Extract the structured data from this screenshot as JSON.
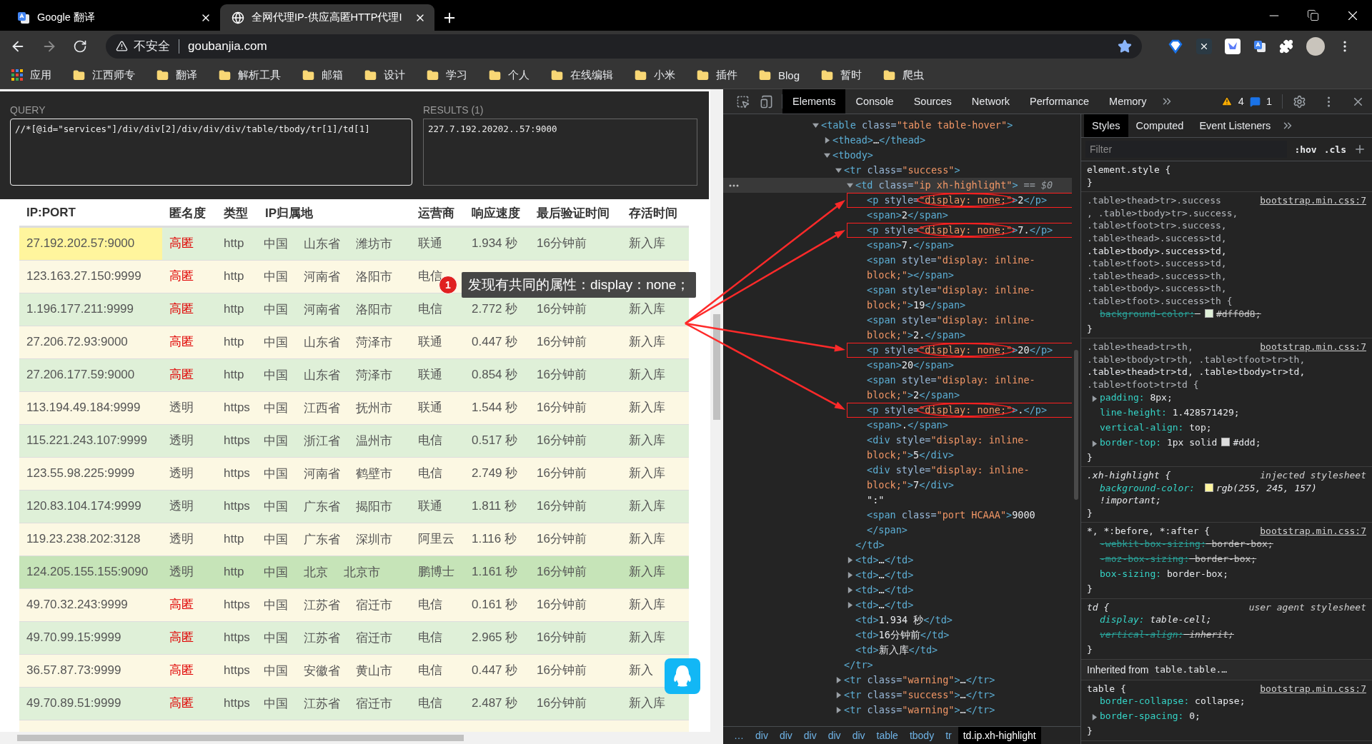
{
  "browser": {
    "tabs": [
      {
        "title": "Google 翻译",
        "kind": "translate",
        "selected": false
      },
      {
        "title": "全网代理IP-供应高匿HTTP代理I",
        "kind": "globe",
        "selected": true
      }
    ],
    "security": "不安全",
    "url": "goubanjia.com",
    "bookmarks": [
      {
        "kind": "apps",
        "label": "应用"
      },
      {
        "kind": "folder",
        "label": "江西师专"
      },
      {
        "kind": "folder",
        "label": "翻译"
      },
      {
        "kind": "folder",
        "label": "解析工具"
      },
      {
        "kind": "folder",
        "label": "邮箱"
      },
      {
        "kind": "folder",
        "label": "设计"
      },
      {
        "kind": "folder",
        "label": "学习"
      },
      {
        "kind": "folder",
        "label": "个人"
      },
      {
        "kind": "folder",
        "label": "在线编辑"
      },
      {
        "kind": "folder",
        "label": "小米"
      },
      {
        "kind": "folder",
        "label": "插件"
      },
      {
        "kind": "folder",
        "label": "Blog"
      },
      {
        "kind": "folder",
        "label": "暂时"
      },
      {
        "kind": "folder",
        "label": "爬虫"
      }
    ]
  },
  "page": {
    "xpath_helper": {
      "query_label": "QUERY",
      "query": "//*[@id=\"services\"]/div/div[2]/div/div/div/table/tbody/tr[1]/td[1]",
      "results_label": "RESULTS (1)",
      "result": "227.7.192.20202..57:9000"
    },
    "columns": [
      "IP:PORT",
      "匿名度",
      "类型",
      "IP归属地",
      "运营商",
      "响应速度",
      "最后验证时间",
      "存活时间"
    ],
    "rows": [
      {
        "kind": "success",
        "hovered": false,
        "ip_highlighted": true,
        "ip": "27.192.202.57:9000",
        "anonymity": "高匿",
        "color": "#e00000",
        "type": "http",
        "location": [
          "中国",
          "山东省",
          "潍坊市"
        ],
        "isp": "联通",
        "speed": "1.934 秒",
        "verified": "16分钟前",
        "lifetime": "新入库"
      },
      {
        "kind": "warning",
        "hovered": false,
        "ip_highlighted": false,
        "ip": "123.163.27.150:9999",
        "anonymity": "高匿",
        "color": "#e00000",
        "type": "http",
        "location": [
          "中国",
          "河南省",
          "洛阳市"
        ],
        "isp": "电信"
      },
      {
        "kind": "success",
        "hovered": false,
        "ip_highlighted": false,
        "ip": "1.196.177.211:9999",
        "anonymity": "高匿",
        "color": "#e00000",
        "type": "http",
        "location": [
          "中国",
          "河南省",
          "洛阳市"
        ],
        "isp": "电信",
        "speed": "2.772 秒",
        "verified": "16分钟前",
        "lifetime": "新入库"
      },
      {
        "kind": "warning",
        "hovered": false,
        "ip_highlighted": false,
        "ip": "27.206.72.93:9000",
        "anonymity": "高匿",
        "color": "#e00000",
        "type": "http",
        "location": [
          "中国",
          "山东省",
          "菏泽市"
        ],
        "isp": "联通",
        "speed": "0.447 秒",
        "verified": "16分钟前",
        "lifetime": "新入库"
      },
      {
        "kind": "success",
        "hovered": false,
        "ip_highlighted": false,
        "ip": "27.206.177.59:9000",
        "anonymity": "高匿",
        "color": "#e00000",
        "type": "http",
        "location": [
          "中国",
          "山东省",
          "菏泽市"
        ],
        "isp": "联通",
        "speed": "0.854 秒",
        "verified": "16分钟前",
        "lifetime": "新入库"
      },
      {
        "kind": "warning",
        "hovered": false,
        "ip_highlighted": false,
        "ip": "113.194.49.184:9999",
        "anonymity": "透明",
        "color": "#555555",
        "type": "https",
        "location": [
          "中国",
          "江西省",
          "抚州市"
        ],
        "isp": "联通",
        "speed": "1.544 秒",
        "verified": "16分钟前",
        "lifetime": "新入库"
      },
      {
        "kind": "success",
        "hovered": false,
        "ip_highlighted": false,
        "ip": "115.221.243.107:9999",
        "anonymity": "透明",
        "color": "#555555",
        "type": "https",
        "location": [
          "中国",
          "浙江省",
          "温州市"
        ],
        "isp": "电信",
        "speed": "0.517 秒",
        "verified": "16分钟前",
        "lifetime": "新入库"
      },
      {
        "kind": "warning",
        "hovered": false,
        "ip_highlighted": false,
        "ip": "123.55.98.225:9999",
        "anonymity": "透明",
        "color": "#555555",
        "type": "https",
        "location": [
          "中国",
          "河南省",
          "鹤壁市"
        ],
        "isp": "电信",
        "speed": "2.749 秒",
        "verified": "16分钟前",
        "lifetime": "新入库"
      },
      {
        "kind": "success",
        "hovered": false,
        "ip_highlighted": false,
        "ip": "120.83.104.174:9999",
        "anonymity": "透明",
        "color": "#555555",
        "type": "https",
        "location": [
          "中国",
          "广东省",
          "揭阳市"
        ],
        "isp": "联通",
        "speed": "1.811 秒",
        "verified": "16分钟前",
        "lifetime": "新入库"
      },
      {
        "kind": "warning",
        "hovered": false,
        "ip_highlighted": false,
        "ip": "119.23.238.202:3128",
        "anonymity": "透明",
        "color": "#555555",
        "type": "http",
        "location": [
          "中国",
          "广东省",
          "深圳市"
        ],
        "isp": "阿里云",
        "speed": "1.116 秒",
        "verified": "16分钟前",
        "lifetime": "新入库"
      },
      {
        "kind": "success",
        "hovered": true,
        "ip_highlighted": false,
        "ip": "124.205.155.155:9090",
        "anonymity": "透明",
        "color": "#555555",
        "type": "http",
        "location": [
          "中国",
          "北京",
          "北京市"
        ],
        "isp": "鹏博士",
        "speed": "1.161 秒",
        "verified": "16分钟前",
        "lifetime": "新入库"
      },
      {
        "kind": "warning",
        "hovered": false,
        "ip_highlighted": false,
        "ip": "49.70.32.243:9999",
        "anonymity": "高匿",
        "color": "#e00000",
        "type": "https",
        "location": [
          "中国",
          "江苏省",
          "宿迁市"
        ],
        "isp": "电信",
        "speed": "0.161 秒",
        "verified": "16分钟前",
        "lifetime": "新入库"
      },
      {
        "kind": "success",
        "hovered": false,
        "ip_highlighted": false,
        "ip": "49.70.99.15:9999",
        "anonymity": "高匿",
        "color": "#e00000",
        "type": "https",
        "location": [
          "中国",
          "江苏省",
          "宿迁市"
        ],
        "isp": "电信",
        "speed": "2.965 秒",
        "verified": "16分钟前",
        "lifetime": "新入库"
      },
      {
        "kind": "warning",
        "hovered": false,
        "ip_highlighted": false,
        "ip": "36.57.87.73:9999",
        "anonymity": "高匿",
        "color": "#e00000",
        "type": "https",
        "location": [
          "中国",
          "安徽省",
          "黄山市"
        ],
        "isp": "电信",
        "speed": "0.447 秒",
        "verified": "16分钟前",
        "lifetime": "新入"
      },
      {
        "kind": "success",
        "hovered": false,
        "ip_highlighted": false,
        "ip": "49.70.89.51:9999",
        "anonymity": "高匿",
        "color": "#e00000",
        "type": "https",
        "location": [
          "中国",
          "江苏省",
          "宿迁市"
        ],
        "isp": "电信",
        "speed": "2.487 秒",
        "verified": "16分钟前",
        "lifetime": "新入库"
      }
    ],
    "annotation": {
      "badge": "1",
      "text": "发现有共同的属性：display：none；"
    }
  },
  "devtools": {
    "tabs": [
      {
        "label": "Elements",
        "selected": true
      },
      {
        "label": "Console",
        "selected": false
      },
      {
        "label": "Sources",
        "selected": false
      },
      {
        "label": "Network",
        "selected": false
      },
      {
        "label": "Performance",
        "selected": false
      },
      {
        "label": "Memory",
        "selected": false
      }
    ],
    "warnings": "4",
    "messages": "1",
    "elements_tree": [
      {
        "kind": "element",
        "markup": "<table class=\"table table-hover\">",
        "expanded": true,
        "selected": false,
        "marked": false,
        "children": [
          {
            "kind": "element",
            "markup": "<thead>…</thead>",
            "expanded": false,
            "selected": false,
            "marked": false
          },
          {
            "kind": "element",
            "markup": "<tbody>",
            "expanded": true,
            "selected": false,
            "marked": false,
            "children": [
              {
                "kind": "element",
                "markup": "<tr class=\"success\">",
                "expanded": true,
                "selected": false,
                "marked": false,
                "close": "</tr>",
                "children": [
                  {
                    "kind": "element",
                    "markup": "<td class=\"ip xh-highlight\">",
                    "suffix": "== $0",
                    "expanded": true,
                    "selected": true,
                    "marked": false,
                    "close": "</td>",
                    "children": [
                      {
                        "kind": "element",
                        "markup": "<p style=\"display: none;\">2</p>",
                        "selected": false,
                        "marked": true
                      },
                      {
                        "kind": "element",
                        "markup": "<span>2</span>",
                        "selected": false,
                        "marked": false
                      },
                      {
                        "kind": "element",
                        "markup": "<p style=\"display: none;\">7.</p>",
                        "selected": false,
                        "marked": true
                      },
                      {
                        "kind": "element",
                        "markup": "<span>7.</span>",
                        "selected": false,
                        "marked": false
                      },
                      {
                        "kind": "element",
                        "markup": "<span style=\"display: inline-block;\"></span>",
                        "selected": false,
                        "marked": false
                      },
                      {
                        "kind": "element",
                        "markup": "<span style=\"display: inline-block;\">19</span>",
                        "selected": false,
                        "marked": false
                      },
                      {
                        "kind": "element",
                        "markup": "<span style=\"display: inline-block;\">2.</span>",
                        "selected": false,
                        "marked": false
                      },
                      {
                        "kind": "element",
                        "markup": "<p style=\"display: none;\">20</p>",
                        "selected": false,
                        "marked": true
                      },
                      {
                        "kind": "element",
                        "markup": "<span>20</span>",
                        "selected": false,
                        "marked": false
                      },
                      {
                        "kind": "element",
                        "markup": "<span style=\"display: inline-block;\">2</span>",
                        "selected": false,
                        "marked": false
                      },
                      {
                        "kind": "element",
                        "markup": "<p style=\"display: none;\">.</p>",
                        "selected": false,
                        "marked": true
                      },
                      {
                        "kind": "element",
                        "markup": "<span>.</span>",
                        "selected": false,
                        "marked": false
                      },
                      {
                        "kind": "element",
                        "markup": "<div style=\"display: inline-block;\">5</div>",
                        "selected": false,
                        "marked": false
                      },
                      {
                        "kind": "element",
                        "markup": "<div style=\"display: inline-block;\">7</div>",
                        "selected": false,
                        "marked": false
                      },
                      {
                        "kind": "text",
                        "markup": "\":\"",
                        "selected": false,
                        "marked": false
                      },
                      {
                        "kind": "element",
                        "markup": "<span class=\"port HCAAA\">9000</span>",
                        "selected": false,
                        "marked": false
                      }
                    ]
                  },
                  {
                    "kind": "element",
                    "markup": "<td>…</td>",
                    "expanded": false,
                    "selected": false,
                    "marked": false
                  },
                  {
                    "kind": "element",
                    "markup": "<td>…</td>",
                    "expanded": false,
                    "selected": false,
                    "marked": false
                  },
                  {
                    "kind": "element",
                    "markup": "<td>…</td>",
                    "expanded": false,
                    "selected": false,
                    "marked": false
                  },
                  {
                    "kind": "element",
                    "markup": "<td>…</td>",
                    "expanded": false,
                    "selected": false,
                    "marked": false
                  },
                  {
                    "kind": "element",
                    "markup": "<td>1.934 秒</td>",
                    "selected": false,
                    "marked": false
                  },
                  {
                    "kind": "element",
                    "markup": "<td>16分钟前</td>",
                    "selected": false,
                    "marked": false
                  },
                  {
                    "kind": "element",
                    "markup": "<td>新入库</td>",
                    "selected": false,
                    "marked": false
                  }
                ]
              },
              {
                "kind": "element",
                "markup": "<tr class=\"warning\">…</tr>",
                "expanded": false,
                "selected": false,
                "marked": false
              },
              {
                "kind": "element",
                "markup": "<tr class=\"success\">…</tr>",
                "expanded": false,
                "selected": false,
                "marked": false
              },
              {
                "kind": "element",
                "markup": "<tr class=\"warning\">…</tr>",
                "expanded": false,
                "selected": false,
                "marked": false
              }
            ]
          }
        ]
      }
    ],
    "breadcrumbs": [
      {
        "text": "…",
        "selected": false
      },
      {
        "text": "div",
        "selected": false
      },
      {
        "text": "div",
        "selected": false
      },
      {
        "text": "div",
        "selected": false
      },
      {
        "text": "div",
        "selected": false
      },
      {
        "text": "div",
        "selected": false
      },
      {
        "text": "table",
        "selected": false
      },
      {
        "text": "tbody",
        "selected": false
      },
      {
        "text": "tr",
        "selected": false
      },
      {
        "text": "td.ip.xh-highlight",
        "selected": true
      }
    ],
    "sidebar_tabs": [
      {
        "label": "Styles",
        "selected": true
      },
      {
        "label": "Computed",
        "selected": false
      },
      {
        "label": "Event Listeners",
        "selected": false
      }
    ],
    "filter": {
      "placeholder": "Filter",
      "hov": ":hov",
      "cls": ".cls"
    },
    "styles": [
      {
        "kind": "author-rule",
        "selector_lines": [
          {
            "text": "element.style {",
            "matched": true
          }
        ],
        "close": "}"
      },
      {
        "kind": "author-rule",
        "source": "bootstrap.min.css:7",
        "selector_lines": [
          {
            "text": ".table>thead>tr>.success",
            "matched": false
          },
          {
            "text": ", .table>tbody>tr>.success,",
            "matched": false
          },
          {
            "text": ".table>tfoot>tr>.success,",
            "matched": false
          },
          {
            "text": ".table>thead>.success>td,",
            "matched": false
          },
          {
            "text": ".table>tbody>.success>td,",
            "matched": true
          },
          {
            "text": ".table>tfoot>.success>td,",
            "matched": false
          },
          {
            "text": ".table>thead>.success>th,",
            "matched": false
          },
          {
            "text": ".table>tbody>.success>th,",
            "matched": false
          },
          {
            "text": ".table>tfoot>.success>th {",
            "matched": false
          }
        ],
        "props": [
          {
            "name": "background-color:",
            "expandable": false,
            "struck": true,
            "color": "#dff0d8",
            "color_value": "#dff0d8;"
          }
        ],
        "close": "}"
      },
      {
        "kind": "author-rule",
        "source": "bootstrap.min.css:7",
        "selector_lines": [
          {
            "text": ".table>thead>tr>th,",
            "matched": false
          },
          {
            "text": ".table>tbody>tr>th, .table>tfoot>tr>th,",
            "matched": false
          },
          {
            "text": ".table>thead>tr>td, .table>tbody>tr>td,",
            "matched": true
          },
          {
            "text": ".table>tfoot>tr>td {",
            "matched": false
          }
        ],
        "props": [
          {
            "name": "padding:",
            "expandable": true,
            "struck": false,
            "value": "8px;"
          },
          {
            "name": "line-height:",
            "expandable": false,
            "struck": false,
            "value": "1.428571429;"
          },
          {
            "name": "vertical-align:",
            "expandable": false,
            "struck": false,
            "value": "top;"
          },
          {
            "name": "border-top:",
            "expandable": true,
            "struck": false,
            "value": "1px solid",
            "color": "#dddddd",
            "color_value": "#ddd;"
          }
        ],
        "close": "}"
      },
      {
        "kind": "injected-rule",
        "source": "injected stylesheet",
        "selector_lines": [
          {
            "text": ".xh-highlight {",
            "matched": true
          }
        ],
        "props": [
          {
            "name": "background-color:",
            "expandable": false,
            "struck": false,
            "color": "#fff59d",
            "color_value": "rgb(255, 245, 157) !important;"
          }
        ],
        "close": "}"
      },
      {
        "kind": "author-rule",
        "source": "bootstrap.min.css:7",
        "selector_lines": [
          {
            "text": "*, *:before, *:after {",
            "matched": true
          }
        ],
        "props": [
          {
            "name": "-webkit-box-sizing:",
            "expandable": false,
            "struck": true,
            "value": "border-box;"
          },
          {
            "name": "-moz-box-sizing:",
            "expandable": false,
            "struck": true,
            "value": "border-box;"
          },
          {
            "name": "box-sizing:",
            "expandable": false,
            "struck": false,
            "value": "border-box;"
          }
        ],
        "close": "}"
      },
      {
        "kind": "user-agent-rule",
        "source": "user agent stylesheet",
        "selector_lines": [
          {
            "text": "td {",
            "matched": true
          }
        ],
        "props": [
          {
            "name": "display:",
            "expandable": false,
            "struck": false,
            "value": "table-cell;"
          },
          {
            "name": "vertical-align:",
            "expandable": false,
            "struck": true,
            "value": "inherit;"
          }
        ],
        "close": "}"
      },
      {
        "kind": "inherited",
        "label": "Inherited from",
        "target": "table.table.…"
      },
      {
        "kind": "author-rule",
        "source": "bootstrap.min.css:7",
        "selector_lines": [
          {
            "text": "table {",
            "matched": true
          }
        ],
        "props": [
          {
            "name": "border-collapse:",
            "expandable": false,
            "struck": false,
            "value": "collapse;"
          },
          {
            "name": "border-spacing:",
            "expandable": true,
            "struck": false,
            "value": "0;"
          }
        ],
        "close": "}"
      }
    ]
  }
}
